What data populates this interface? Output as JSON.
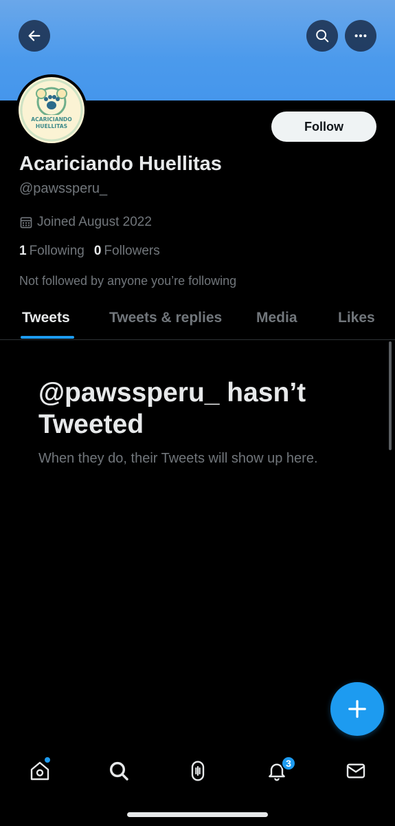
{
  "profile": {
    "display_name": "Acariciando Huellitas",
    "handle": "@pawssperu_",
    "joined": "Joined August 2022",
    "following_count": "1",
    "following_label": "Following",
    "followers_count": "0",
    "followers_label": "Followers",
    "not_followed": "Not followed by anyone you’re following",
    "avatar_text": [
      "ACARICIANDO",
      "HUELLITAS"
    ]
  },
  "actions": {
    "follow_label": "Follow"
  },
  "tabs": [
    {
      "label": "Tweets",
      "active": true
    },
    {
      "label": "Tweets & replies",
      "active": false
    },
    {
      "label": "Media",
      "active": false
    },
    {
      "label": "Likes",
      "active": false
    }
  ],
  "empty_state": {
    "title": "@pawssperu_ hasn’t Tweeted",
    "subtitle": "When they do, their Tweets will show up here."
  },
  "nav": {
    "items": [
      "home-icon",
      "search-icon",
      "spaces-icon",
      "notifications-icon",
      "messages-icon"
    ],
    "notification_badge": "3"
  },
  "colors": {
    "accent": "#1d9bf0",
    "banner": "#4b9aec",
    "background": "#000000"
  }
}
